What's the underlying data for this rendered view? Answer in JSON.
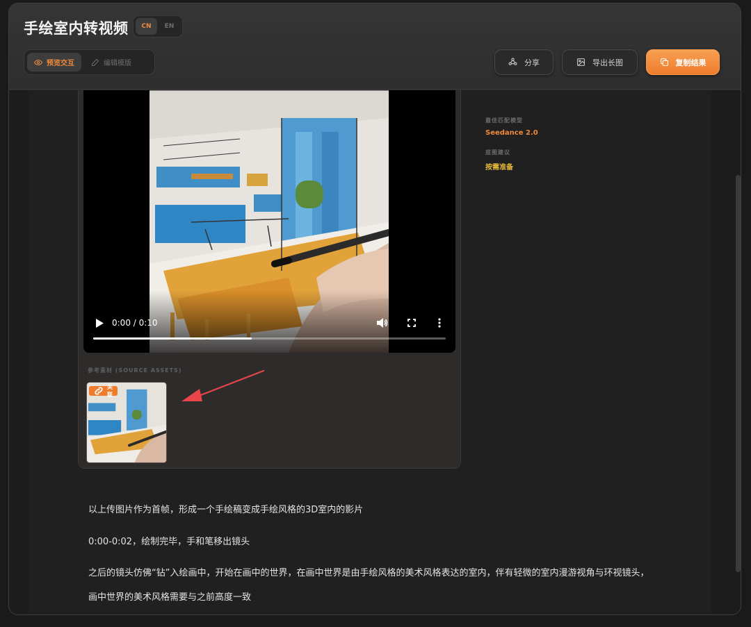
{
  "app": {
    "title": "手绘室内转视频"
  },
  "language_toggle": {
    "options": [
      "CN",
      "EN"
    ],
    "selected": "CN"
  },
  "view_mode": {
    "preview_label": "预览交互",
    "edit_label": "编辑模版",
    "selected": "preview"
  },
  "toolbar": {
    "share_label": "分享",
    "export_label": "导出长图",
    "copy_label": "复制结果"
  },
  "video": {
    "time": "0:00 / 0:10",
    "progress": 0.45
  },
  "assets": {
    "section_label": "参考素材 (SOURCE ASSETS)",
    "items": [
      {
        "badge": "关联"
      }
    ]
  },
  "meta": {
    "model_label": "最佳匹配模型",
    "model_value": "Seedance 2.0",
    "ref_label": "底图建议",
    "ref_value": "按需准备"
  },
  "prompt": {
    "lines": [
      "以上传图片作为首帧，形成一个手绘稿变成手绘风格的3D室内的影片",
      "0:00-0:02，绘制完毕，手和笔移出镜头",
      "之后的镜头仿佛“钻”入绘画中，开始在画中的世界，在画中世界是由手绘风格的美术风格表达的室内，伴有轻微的室内漫游视角与环视镜头，",
      "画中世界的美术风格需要与之前高度一致"
    ]
  },
  "colors": {
    "accent": "#ef8a3c",
    "accent_strong": "#ef7c2c",
    "highlight_yellow": "#e7b93a",
    "annotation_arrow": "#e8454a"
  }
}
